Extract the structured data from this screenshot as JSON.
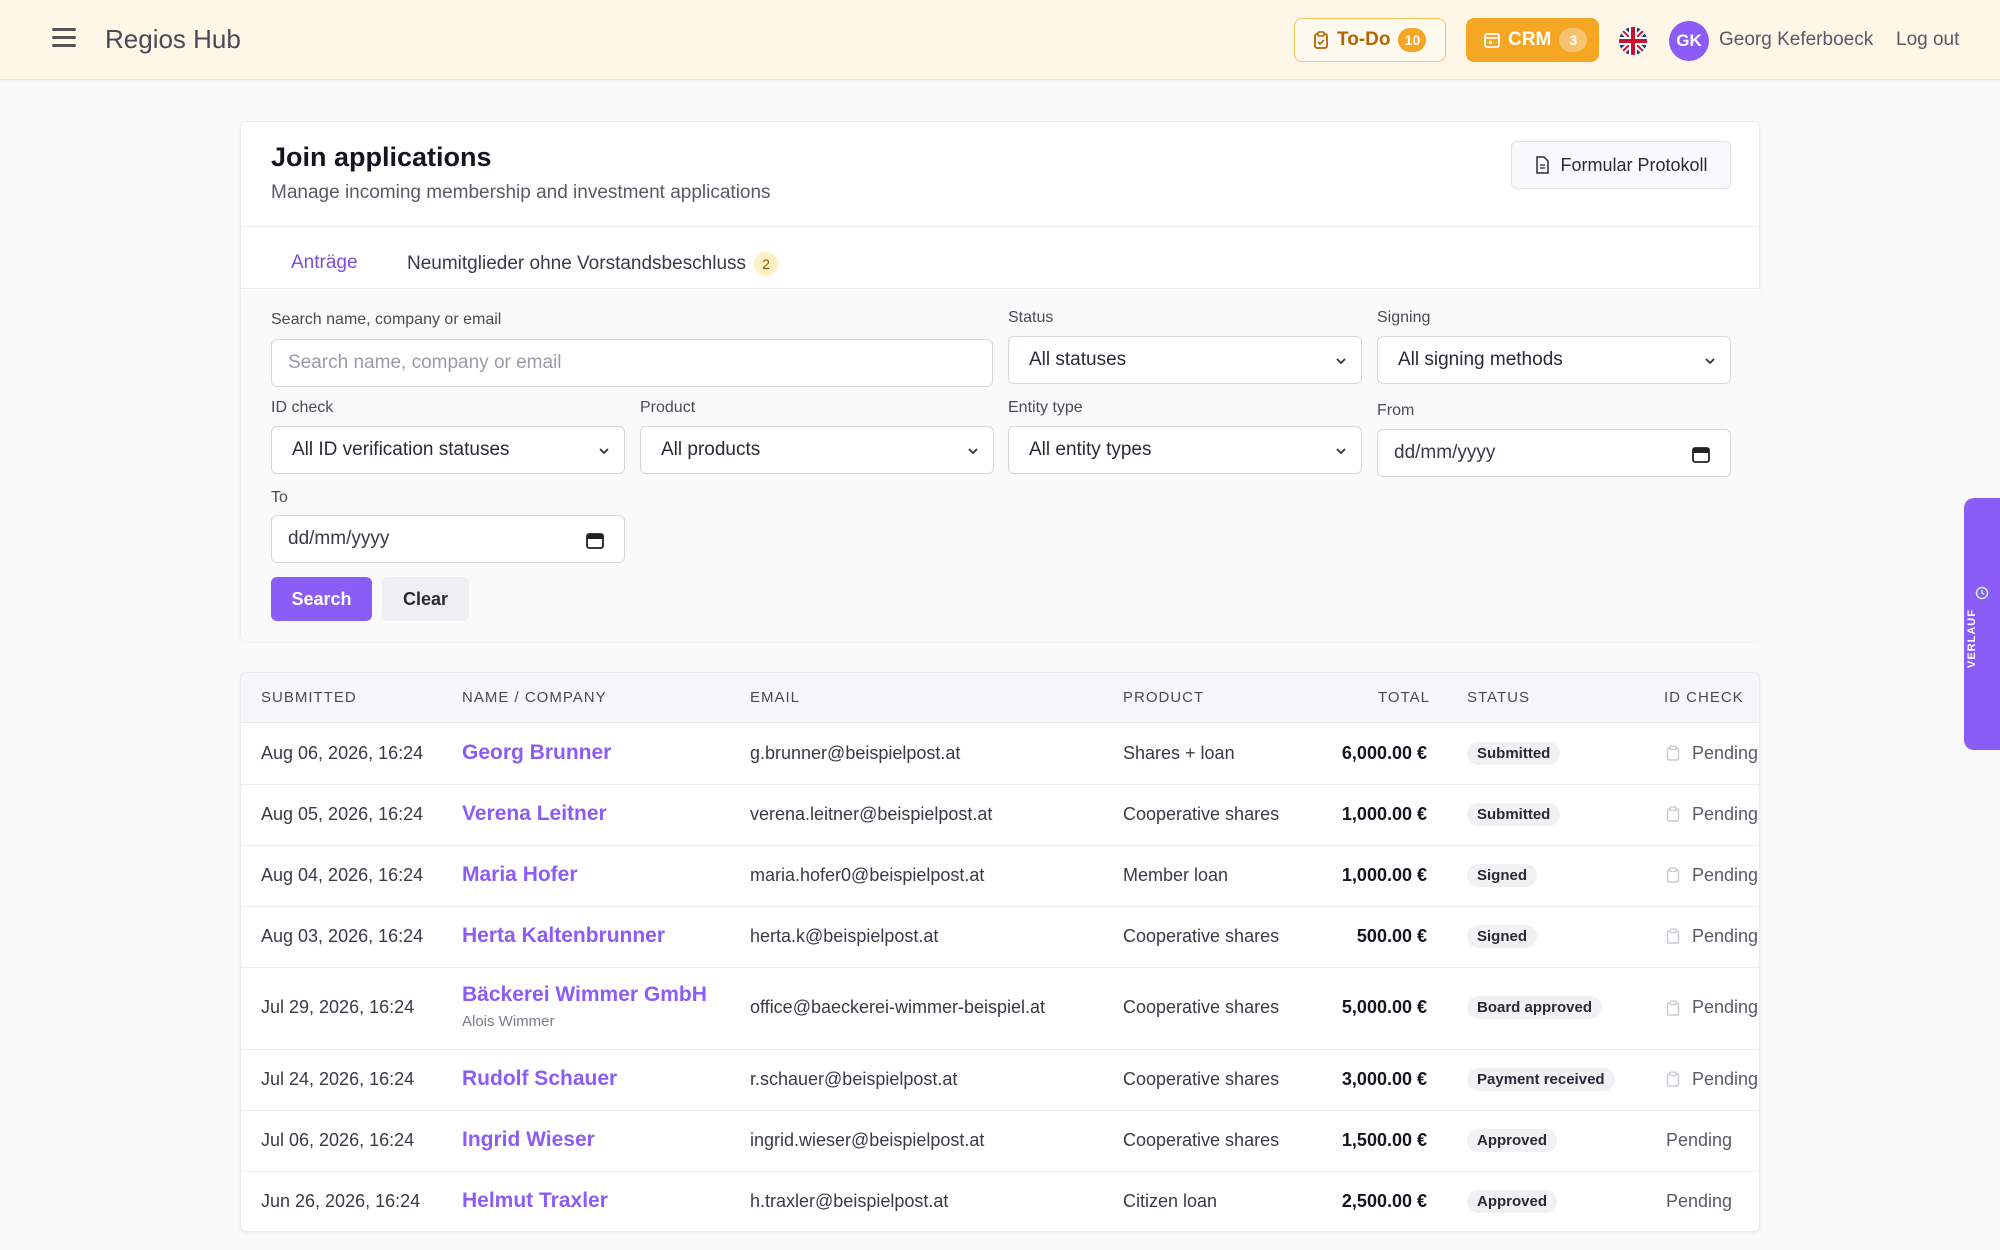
{
  "header": {
    "app_title": "Regios Hub",
    "todo": {
      "label": "To-Do",
      "count": "10"
    },
    "crm": {
      "label": "CRM",
      "count": "3"
    },
    "avatar_initials": "GK",
    "user_name": "Georg Keferboeck",
    "logout_label": "Log out"
  },
  "page": {
    "title": "Join applications",
    "subtitle": "Manage incoming membership and investment applications",
    "protokoll_label": "Formular Protokoll"
  },
  "tabs": [
    {
      "label": "Anträge",
      "active": true
    },
    {
      "label": "Neumitglieder ohne Vorstandsbeschluss",
      "badge": "2"
    }
  ],
  "filters": {
    "search": {
      "label": "Search name, company or email",
      "placeholder": "Search name, company or email"
    },
    "status": {
      "label": "Status",
      "value": "All statuses"
    },
    "signing": {
      "label": "Signing",
      "value": "All signing methods"
    },
    "id_check": {
      "label": "ID check",
      "value": "All ID verification statuses"
    },
    "product": {
      "label": "Product",
      "value": "All products"
    },
    "entity_type": {
      "label": "Entity type",
      "value": "All entity types"
    },
    "from": {
      "label": "From",
      "placeholder": "dd/mm/yyyy"
    },
    "to": {
      "label": "To",
      "placeholder": "dd/mm/yyyy"
    },
    "search_button": "Search",
    "clear_button": "Clear"
  },
  "table": {
    "columns": [
      "SUBMITTED",
      "NAME / COMPANY",
      "EMAIL",
      "PRODUCT",
      "TOTAL",
      "STATUS",
      "ID CHECK"
    ],
    "rows": [
      {
        "submitted": "Aug 06, 2026, 16:24",
        "name": "Georg Brunner",
        "sub": "",
        "email": "g.brunner@beispielpost.at",
        "product": "Shares + loan",
        "total": "6,000.00 €",
        "status": "Submitted",
        "id_check": "Pending",
        "id_icon": true
      },
      {
        "submitted": "Aug 05, 2026, 16:24",
        "name": "Verena Leitner",
        "sub": "",
        "email": "verena.leitner@beispielpost.at",
        "product": "Cooperative shares",
        "total": "1,000.00 €",
        "status": "Submitted",
        "id_check": "Pending",
        "id_icon": true
      },
      {
        "submitted": "Aug 04, 2026, 16:24",
        "name": "Maria Hofer",
        "sub": "",
        "email": "maria.hofer0@beispielpost.at",
        "product": "Member loan",
        "total": "1,000.00 €",
        "status": "Signed",
        "id_check": "Pending",
        "id_icon": true
      },
      {
        "submitted": "Aug 03, 2026, 16:24",
        "name": "Herta Kaltenbrunner",
        "sub": "",
        "email": "herta.k@beispielpost.at",
        "product": "Cooperative shares",
        "total": "500.00 €",
        "status": "Signed",
        "id_check": "Pending",
        "id_icon": true
      },
      {
        "submitted": "Jul 29, 2026, 16:24",
        "name": "Bäckerei Wimmer GmbH",
        "sub": "Alois Wimmer",
        "email": "office@baeckerei-wimmer-beispiel.at",
        "product": "Cooperative shares",
        "total": "5,000.00 €",
        "status": "Board approved",
        "id_check": "Pending",
        "id_icon": true
      },
      {
        "submitted": "Jul 24, 2026, 16:24",
        "name": "Rudolf Schauer",
        "sub": "",
        "email": "r.schauer@beispielpost.at",
        "product": "Cooperative shares",
        "total": "3,000.00 €",
        "status": "Payment received",
        "id_check": "Pending",
        "id_icon": true
      },
      {
        "submitted": "Jul 06, 2026, 16:24",
        "name": "Ingrid Wieser",
        "sub": "",
        "email": "ingrid.wieser@beispielpost.at",
        "product": "Cooperative shares",
        "total": "1,500.00 €",
        "status": "Approved",
        "id_check": "Pending",
        "id_icon": false
      },
      {
        "submitted": "Jun 26, 2026, 16:24",
        "name": "Helmut Traxler",
        "sub": "",
        "email": "h.traxler@beispielpost.at",
        "product": "Citizen loan",
        "total": "2,500.00 €",
        "status": "Approved",
        "id_check": "Pending",
        "id_icon": false
      }
    ]
  },
  "side_panel": {
    "label": "VERLAUF"
  },
  "colors": {
    "accent": "#8b5cf6",
    "crm": "#f5a623",
    "topbar": "#fef6e6"
  }
}
